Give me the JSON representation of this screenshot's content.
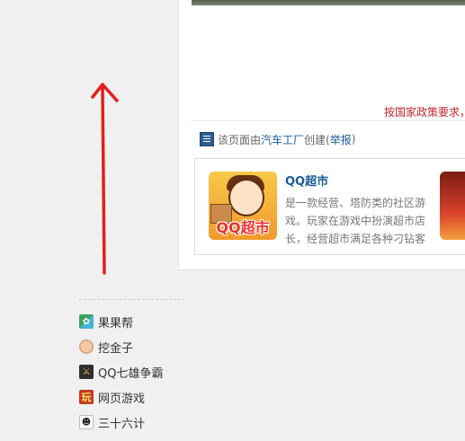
{
  "policy": {
    "text": "按国家政策要求，"
  },
  "creator": {
    "prefix": "该页面由",
    "creator_name": "汽车工厂",
    "middle": "创建(",
    "report_label": "举报",
    "suffix": ")"
  },
  "game_card": {
    "title": "QQ超市",
    "description": "是一款经营、塔防类的社区游戏。玩家在游戏中扮演超市店长，经营超市满足各种刁钻客",
    "thumb_logo": "QQ超市"
  },
  "sidebar": {
    "items": [
      {
        "label": "果果帮",
        "icon": "guoguo-icon",
        "glyph": "✿"
      },
      {
        "label": "挖金子",
        "icon": "dig-gold-icon",
        "glyph": ""
      },
      {
        "label": "QQ七雄争霸",
        "icon": "qixiong-icon",
        "glyph": "⚔"
      },
      {
        "label": "网页游戏",
        "icon": "wan-icon",
        "glyph": "玩"
      },
      {
        "label": "三十六计",
        "icon": "panda-icon",
        "glyph": "☻"
      }
    ]
  },
  "colors": {
    "accent_red": "#c0272d",
    "link_blue": "#1a5c9a",
    "annotation_arrow": "#e41e1e"
  }
}
